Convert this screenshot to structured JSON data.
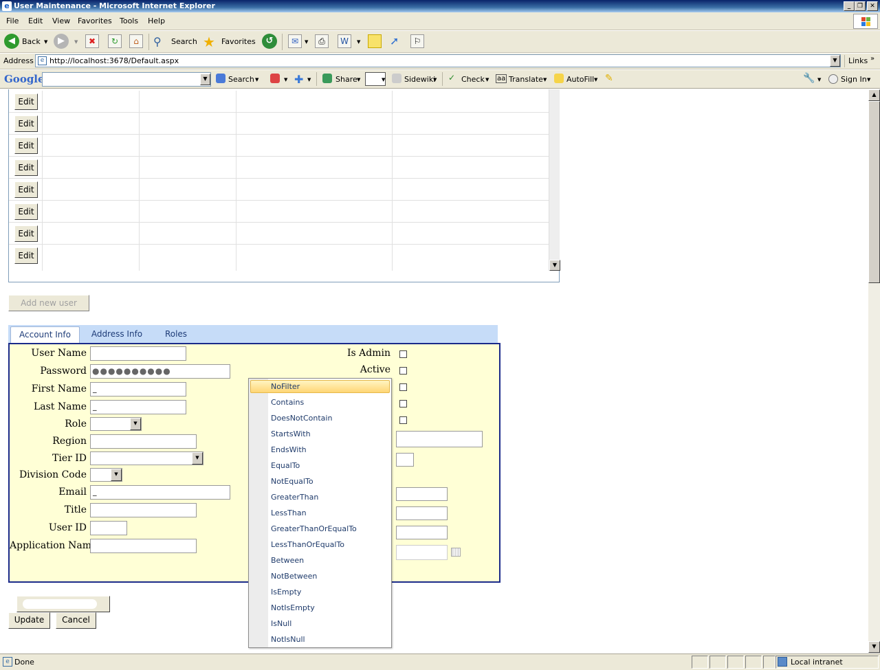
{
  "window": {
    "title": "User Maintenance - Microsoft Internet Explorer"
  },
  "menu": [
    "File",
    "Edit",
    "View",
    "Favorites",
    "Tools",
    "Help"
  ],
  "toolbar": {
    "back_label": "Back",
    "search_label": "Search",
    "favorites_label": "Favorites"
  },
  "address": {
    "label": "Address",
    "url": "http://localhost:3678/Default.aspx",
    "links_label": "Links"
  },
  "google_bar": {
    "logo": "Google",
    "search_label": "Search",
    "share_label": "Share",
    "sidewiki_label": "Sidewiki",
    "check_label": "Check",
    "translate_label": "Translate",
    "autofill_label": "AutoFill",
    "signin_label": "Sign In"
  },
  "grid": {
    "edit_label": "Edit",
    "row_count": 8
  },
  "add_user_label": "Add new user",
  "tabs": [
    "Account Info",
    "Address Info",
    "Roles"
  ],
  "form": {
    "user_name_label": "User Name",
    "password_label": "Password",
    "password_mask": "●●●●●●●●●●",
    "first_name_label": "First Name",
    "last_name_label": "Last Name",
    "role_label": "Role",
    "region_label": "Region",
    "tier_id_label": "Tier ID",
    "division_code_label": "Division Code",
    "email_label": "Email",
    "title_label": "Title",
    "user_id_label": "User ID",
    "application_name_label": "Application Name",
    "is_admin_label": "Is Admin",
    "active_label": "Active",
    "first_name_value": "_",
    "last_name_value": "_",
    "email_value": "_"
  },
  "filter_menu": {
    "items": [
      "NoFilter",
      "Contains",
      "DoesNotContain",
      "StartsWith",
      "EndsWith",
      "EqualTo",
      "NotEqualTo",
      "GreaterThan",
      "LessThan",
      "GreaterThanOrEqualTo",
      "LessThanOrEqualTo",
      "Between",
      "NotBetween",
      "IsEmpty",
      "NotIsEmpty",
      "IsNull",
      "NotIsNull"
    ],
    "selected": "NoFilter"
  },
  "buttons": {
    "update_label": "Update",
    "cancel_label": "Cancel"
  },
  "status": {
    "text": "Done",
    "zone": "Local intranet"
  }
}
